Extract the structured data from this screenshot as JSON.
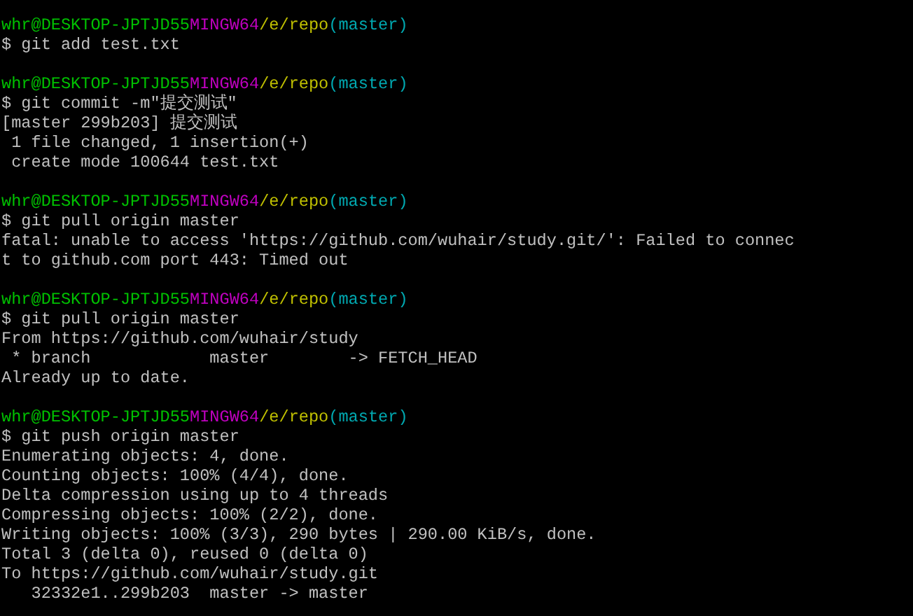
{
  "terminal": {
    "lines": [
      {
        "kind": "prompt",
        "user_host": "whr@DESKTOP-JPTJD55",
        "system": "MINGW64",
        "path": "/e/repo",
        "branch": "(master)"
      },
      {
        "kind": "command",
        "text": "$ git add test.txt"
      },
      {
        "kind": "blank"
      },
      {
        "kind": "prompt",
        "user_host": "whr@DESKTOP-JPTJD55",
        "system": "MINGW64",
        "path": "/e/repo",
        "branch": "(master)"
      },
      {
        "kind": "command",
        "text": "$ git commit -m\"提交测试\""
      },
      {
        "kind": "output",
        "text": "[master 299b203] 提交测试"
      },
      {
        "kind": "output",
        "text": " 1 file changed, 1 insertion(+)"
      },
      {
        "kind": "output",
        "text": " create mode 100644 test.txt"
      },
      {
        "kind": "blank"
      },
      {
        "kind": "prompt",
        "user_host": "whr@DESKTOP-JPTJD55",
        "system": "MINGW64",
        "path": "/e/repo",
        "branch": "(master)"
      },
      {
        "kind": "command",
        "text": "$ git pull origin master"
      },
      {
        "kind": "output",
        "text": "fatal: unable to access 'https://github.com/wuhair/study.git/': Failed to connec"
      },
      {
        "kind": "output",
        "text": "t to github.com port 443: Timed out"
      },
      {
        "kind": "blank"
      },
      {
        "kind": "prompt",
        "user_host": "whr@DESKTOP-JPTJD55",
        "system": "MINGW64",
        "path": "/e/repo",
        "branch": "(master)"
      },
      {
        "kind": "command",
        "text": "$ git pull origin master"
      },
      {
        "kind": "output",
        "text": "From https://github.com/wuhair/study"
      },
      {
        "kind": "output",
        "text": " * branch            master        -> FETCH_HEAD"
      },
      {
        "kind": "output",
        "text": "Already up to date."
      },
      {
        "kind": "blank"
      },
      {
        "kind": "prompt",
        "user_host": "whr@DESKTOP-JPTJD55",
        "system": "MINGW64",
        "path": "/e/repo",
        "branch": "(master)"
      },
      {
        "kind": "command",
        "text": "$ git push origin master"
      },
      {
        "kind": "output",
        "text": "Enumerating objects: 4, done."
      },
      {
        "kind": "output",
        "text": "Counting objects: 100% (4/4), done."
      },
      {
        "kind": "output",
        "text": "Delta compression using up to 4 threads"
      },
      {
        "kind": "output",
        "text": "Compressing objects: 100% (2/2), done."
      },
      {
        "kind": "output",
        "text": "Writing objects: 100% (3/3), 290 bytes | 290.00 KiB/s, done."
      },
      {
        "kind": "output",
        "text": "Total 3 (delta 0), reused 0 (delta 0)"
      },
      {
        "kind": "output",
        "text": "To https://github.com/wuhair/study.git"
      },
      {
        "kind": "output",
        "text": "   32332e1..299b203  master -> master"
      }
    ]
  }
}
